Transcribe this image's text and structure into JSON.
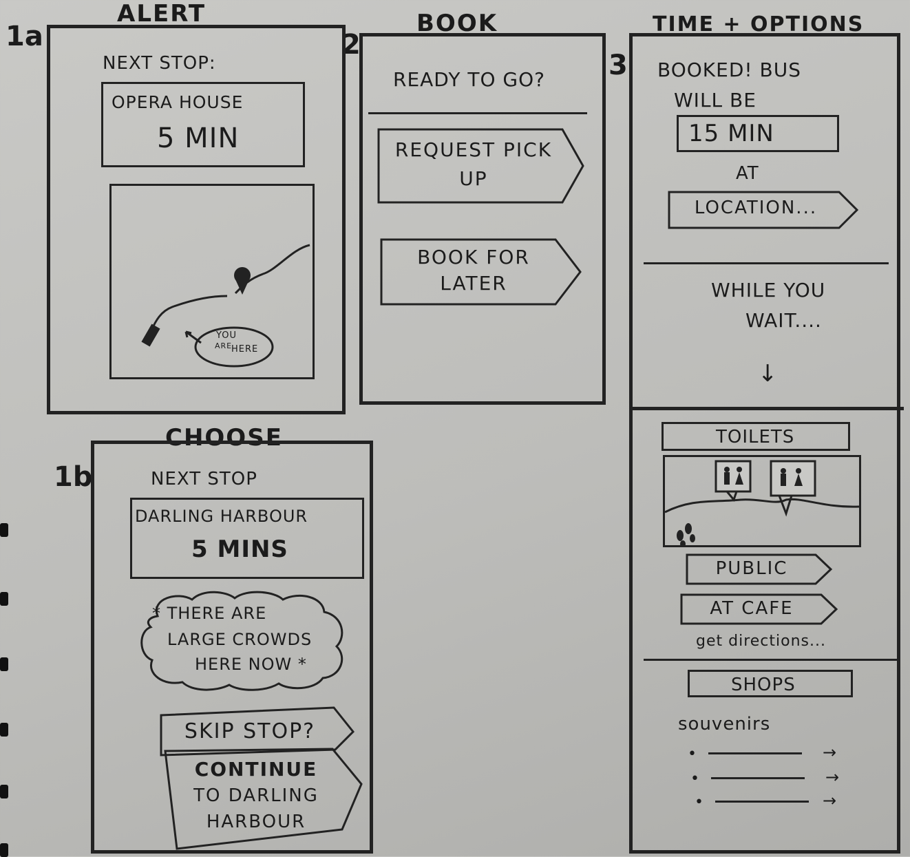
{
  "headings": {
    "alert": "ALERT",
    "book": "BOOK",
    "time_options": "TIME + OPTIONS",
    "choose": "CHOOSE"
  },
  "numbers": {
    "n1a": "1a",
    "n2": "2",
    "n3": "3",
    "n1b": "1b"
  },
  "screen1a": {
    "next_stop_label": "NEXT STOP:",
    "stop_name": "OPERA HOUSE",
    "eta": "5 MIN",
    "map_bubble_line1": "YOU",
    "map_bubble_line2": "ARE",
    "map_bubble_line3": "HERE"
  },
  "screen2": {
    "prompt": "READY TO GO?",
    "request_line1": "REQUEST PICK",
    "request_line2": "UP",
    "book_line1": "BOOK FOR",
    "book_line2": "LATER"
  },
  "screen3": {
    "booked_line1": "BOOKED! BUS",
    "booked_line2": "WILL BE",
    "eta": "15 MIN",
    "at_label": "AT",
    "location": "LOCATION...",
    "wait_line1": "WHILE YOU",
    "wait_line2": "WAIT....",
    "toilets_header": "TOILETS",
    "public_button": "PUBLIC",
    "cafe_button": "AT CAFE",
    "directions_link": "get directions...",
    "shops_header": "SHOPS",
    "souvenirs_label": "souvenirs"
  },
  "screen1b": {
    "next_stop_label": "NEXT STOP",
    "stop_name": "DARLING HARBOUR",
    "eta": "5 MINS",
    "crowd_line1": "* THERE ARE",
    "crowd_line2": "LARGE CROWDS",
    "crowd_line3": "HERE NOW *",
    "skip_button": "SKIP STOP?",
    "continue_line1": "CONTINUE",
    "continue_line2": "TO DARLING",
    "continue_line3": "HARBOUR"
  }
}
